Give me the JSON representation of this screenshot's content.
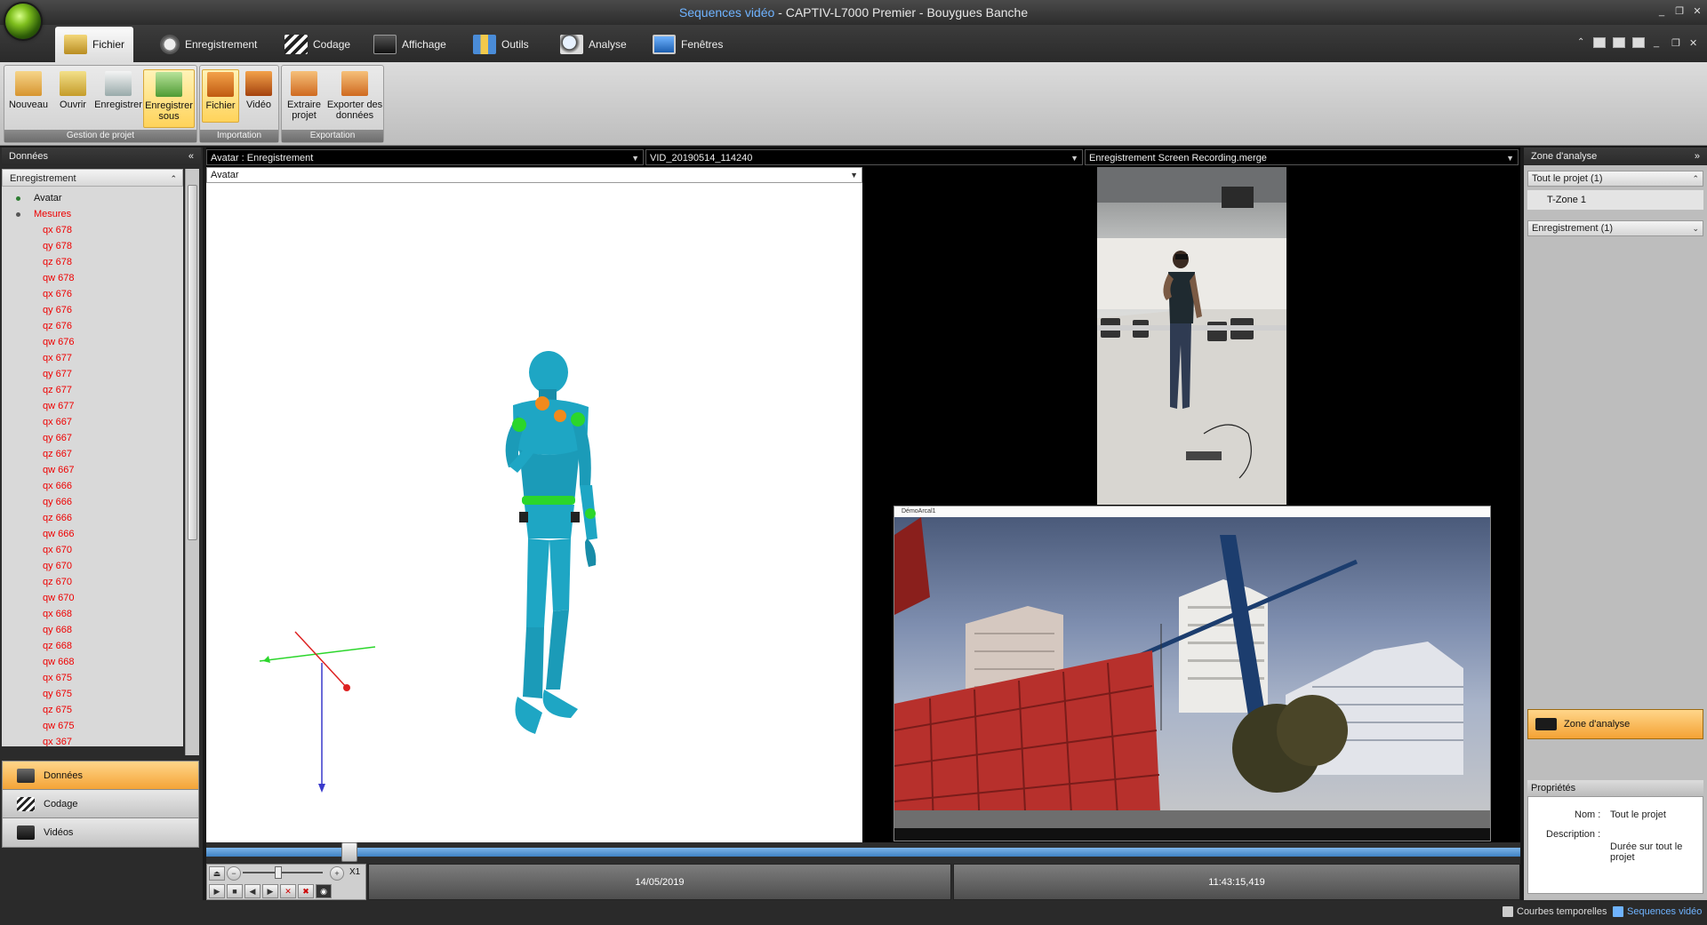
{
  "window": {
    "title_accent": "Sequences vidéo",
    "title_rest": " - CAPTIV-L7000 Premier - Bouygues Banche",
    "min_label": "_",
    "restore_label": "❐",
    "close_label": "✕"
  },
  "tabs": [
    {
      "label": "Fichier",
      "icon": "folder-icon"
    },
    {
      "label": "Enregistrement",
      "icon": "stopwatch-icon"
    },
    {
      "label": "Codage",
      "icon": "clapperboard-icon"
    },
    {
      "label": "Affichage",
      "icon": "monitor-icon"
    },
    {
      "label": "Outils",
      "icon": "tools-icon"
    },
    {
      "label": "Analyse",
      "icon": "magnifier-icon"
    },
    {
      "label": "Fenêtres",
      "icon": "windows-icon"
    }
  ],
  "ribbon": {
    "groups": [
      {
        "title": "Gestion de projet",
        "buttons": [
          "Nouveau",
          "Ouvrir",
          "Enregistrer",
          "Enregistrer sous"
        ]
      },
      {
        "title": "Importation",
        "buttons": [
          "Fichier",
          "Vidéo"
        ]
      },
      {
        "title": "Exportation",
        "buttons": [
          "Extraire projet",
          "Exporter des données"
        ]
      }
    ]
  },
  "left": {
    "header": "Données",
    "collapse": "«",
    "section": "Enregistrement",
    "section_chev": "⌃",
    "tree_roots": [
      "Avatar",
      "Mesures"
    ],
    "tree_leaves": [
      "qx 678",
      "qy 678",
      "qz 678",
      "qw 678",
      "qx 676",
      "qy 676",
      "qz 676",
      "qw 676",
      "qx 677",
      "qy 677",
      "qz 677",
      "qw 677",
      "qx 667",
      "qy 667",
      "qz 667",
      "qw 667",
      "qx 666",
      "qy 666",
      "qz 666",
      "qw 666",
      "qx 670",
      "qy 670",
      "qz 670",
      "qw 670",
      "qx 668",
      "qy 668",
      "qz 668",
      "qw 668",
      "qx 675",
      "qy 675",
      "qz 675",
      "qw 675",
      "qx 367"
    ],
    "nav": [
      "Données",
      "Codage",
      "Vidéos"
    ]
  },
  "center": {
    "view1_header": "Avatar : Enregistrement",
    "view2_header": "VID_20190514_114240",
    "view3_header": "Enregistrement Screen Recording.merge",
    "avatar_select": "Avatar",
    "game_window_title": "DémoArcal1",
    "zoom_label": "X1",
    "date": "14/05/2019",
    "time": "11:43:15,419"
  },
  "right": {
    "header": "Zone d'analyse",
    "collapse": "»",
    "section1": "Tout le projet (1)",
    "tzone": "T-Zone 1",
    "section2": "Enregistrement (1)",
    "zone_button": "Zone d'analyse",
    "props_title": "Propriétés",
    "name_label": "Nom :",
    "name_value": "Tout le projet",
    "desc_label": "Description :",
    "desc_value": "Durée sur tout le projet"
  },
  "status": {
    "item1": "Courbes temporelles",
    "item2": "Sequences vidéo"
  },
  "colors": {
    "accent_blue": "#6fb3ff",
    "highlight_orange": "#f4a234",
    "measure_red": "#e00000",
    "avatar_cyan": "#1ea6c4"
  }
}
